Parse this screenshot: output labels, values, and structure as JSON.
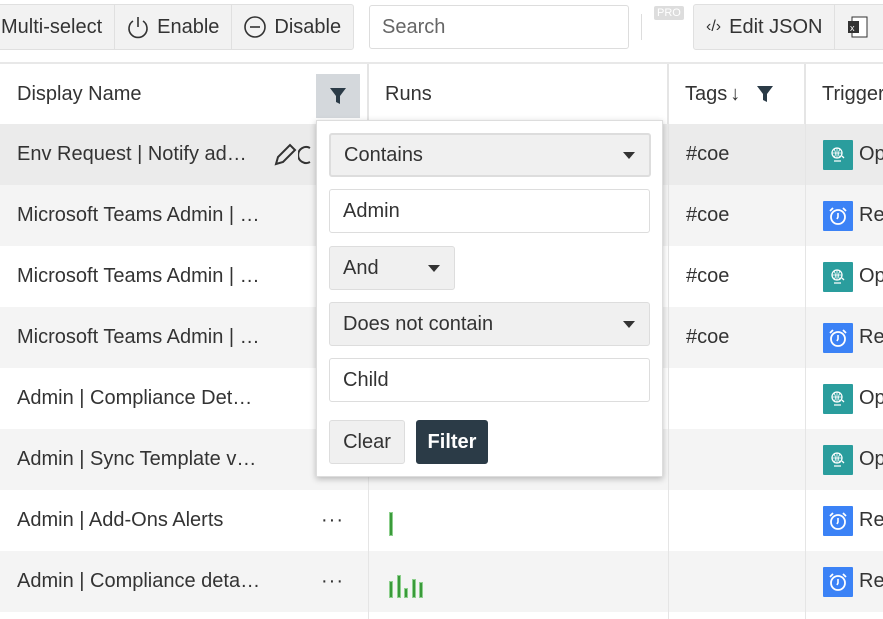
{
  "toolbar": {
    "multiselect_label": "Multi-select",
    "enable_label": "Enable",
    "disable_label": "Disable",
    "search_placeholder": "Search",
    "pro_badge": "PRO",
    "edit_json_label": "Edit JSON"
  },
  "columns": {
    "display_name": "Display Name",
    "runs": "Runs",
    "tags": "Tags",
    "tags_sort": "↓",
    "trigger": "Trigger"
  },
  "rows": [
    {
      "name": "Env Request | Notify ad…",
      "tag": "#coe",
      "trigger": "Op",
      "trigger_type": "globe"
    },
    {
      "name": "Microsoft Teams Admin | …",
      "tag": "#coe",
      "trigger": "Re",
      "trigger_type": "alarm"
    },
    {
      "name": "Microsoft Teams Admin | …",
      "tag": "#coe",
      "trigger": "Op",
      "trigger_type": "globe"
    },
    {
      "name": "Microsoft Teams Admin | …",
      "tag": "#coe",
      "trigger": "Re",
      "trigger_type": "alarm"
    },
    {
      "name": "Admin | Compliance Det…",
      "tag": "",
      "trigger": "Op",
      "trigger_type": "globe"
    },
    {
      "name": "Admin | Sync Template v…",
      "tag": "",
      "trigger": "Op",
      "trigger_type": "globe"
    },
    {
      "name": "Admin | Add-Ons Alerts",
      "tag": "",
      "trigger": "Re",
      "trigger_type": "alarm",
      "more": "···",
      "runs": [
        1
      ]
    },
    {
      "name": "Admin | Compliance deta…",
      "tag": "",
      "trigger": "Re",
      "trigger_type": "alarm",
      "more": "···",
      "runs": [
        0.7,
        0.95,
        0.4,
        0.8,
        0.65
      ]
    }
  ],
  "filter": {
    "op1": "Contains",
    "value1": "Admin",
    "join": "And",
    "op2": "Does not contain",
    "value2": "Child",
    "clear_label": "Clear",
    "filter_label": "Filter"
  },
  "colors": {
    "globe": "#2a9d9d",
    "alarm": "#3b82f6",
    "runs": "#3a9a3a",
    "filter_btn": "#2b3b47"
  }
}
